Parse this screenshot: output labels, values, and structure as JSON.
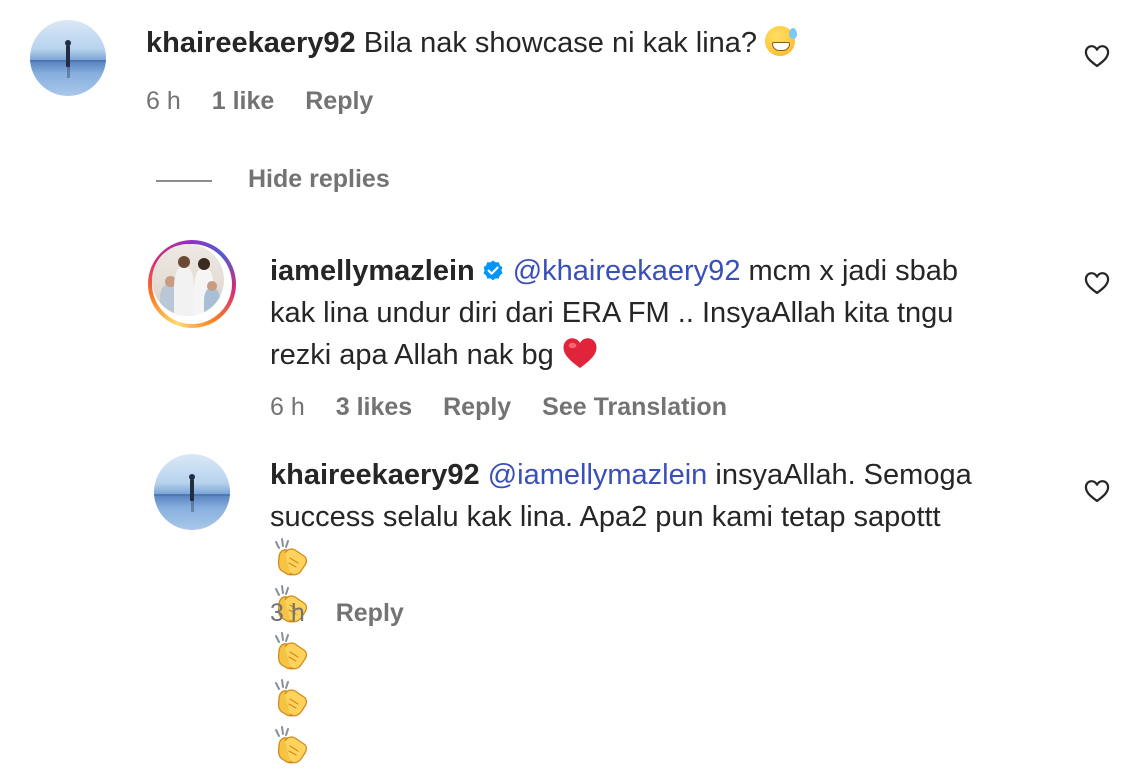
{
  "comments": [
    {
      "username": "khaireekaery92",
      "text": "Bila nak showcase ni kak lina?",
      "emoji": "sweat-smile",
      "time": "6 h",
      "likes": "1 like",
      "reply": "Reply"
    }
  ],
  "replies_toggle": "Hide replies",
  "replies": [
    {
      "username": "iamellymazlein",
      "verified": true,
      "mention": "@khaireekaery92",
      "line1": " mcm x jadi sbab",
      "line2": "kak lina undur diri dari ERA FM .. InsyaAllah kita tngu",
      "line3": "rezki apa Allah nak bg",
      "emoji": "red-heart",
      "time": "6 h",
      "likes": "3 likes",
      "reply": "Reply",
      "translate": "See Translation"
    },
    {
      "username": "khaireekaery92",
      "mention": "@iamellymazlein",
      "line1": " insyaAllah. Semoga",
      "line2": "success selalu kak lina. Apa2 pun kami tetap sapottt",
      "emoji": "clapping-hands",
      "emoji_count": 5,
      "time": "3 h",
      "reply": "Reply"
    }
  ],
  "icons": {
    "like": "heart-outline-icon",
    "verified": "verified-badge-icon"
  },
  "colors": {
    "mention": "#3950b8",
    "meta": "#737373",
    "text": "#262626",
    "verified": "#0095f6"
  }
}
